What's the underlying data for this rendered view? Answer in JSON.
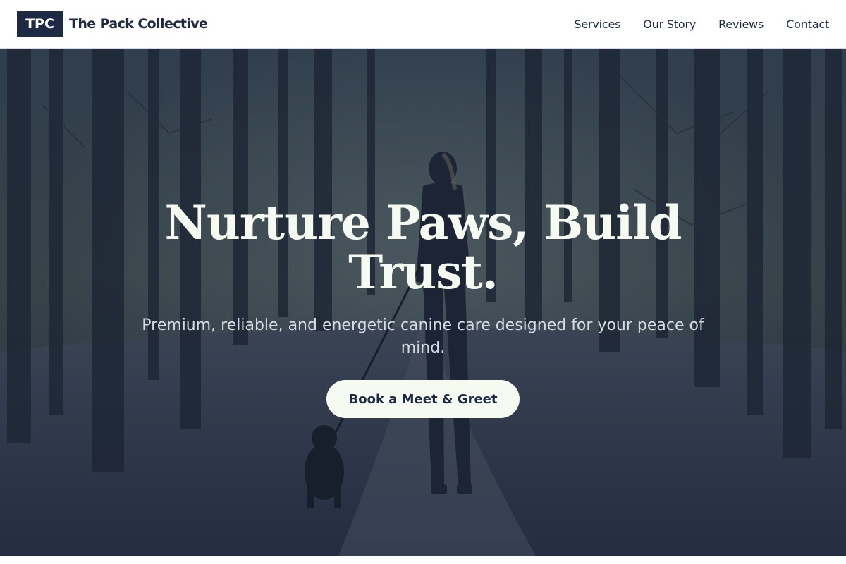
{
  "header": {
    "logo_text": "TPC",
    "brand_name": "The Pack Collective",
    "nav": [
      {
        "label": "Services"
      },
      {
        "label": "Our Story"
      },
      {
        "label": "Reviews"
      },
      {
        "label": "Contact"
      }
    ]
  },
  "hero": {
    "title": "Nurture Paws, Build Trust.",
    "subtitle": "Premium, reliable, and energetic canine care designed for your peace of mind.",
    "cta_label": "Book a Meet & Greet",
    "photo": "woman-walking-dog-in-forest"
  },
  "colors": {
    "brand_navy": "#1e2a44",
    "cta_background": "#f6fbf2",
    "hero_title": "#f6fbf2"
  }
}
